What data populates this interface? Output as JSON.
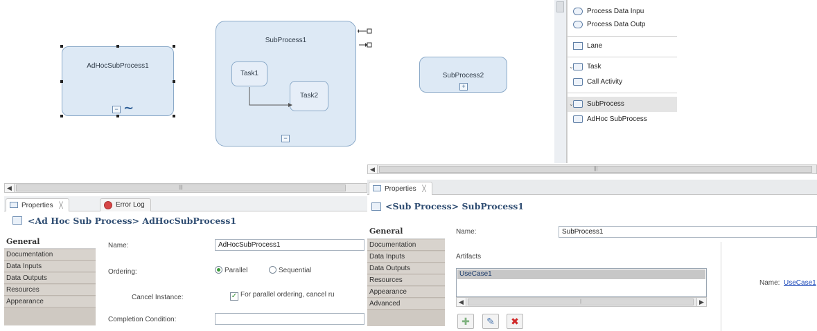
{
  "canvas": {
    "adhoc_label": "AdHocSubProcess1",
    "subprocess1_label": "SubProcess1",
    "task1_label": "Task1",
    "task2_label": "Task2",
    "subprocess2_label": "SubProcess2",
    "collapse_glyph": "−",
    "expand_glyph": "+",
    "adhoc_marker_glyph": "∼"
  },
  "palette": {
    "items": [
      {
        "label": "Process Data Inpu",
        "icon": "data-input-icon"
      },
      {
        "label": "Process Data Outp",
        "icon": "data-output-icon"
      },
      {
        "label": "Lane",
        "icon": "lane-icon"
      },
      {
        "label": "Task",
        "icon": "task-icon"
      },
      {
        "label": "Call Activity",
        "icon": "call-activity-icon"
      },
      {
        "label": "SubProcess",
        "icon": "subprocess-icon"
      },
      {
        "label": "AdHoc SubProcess",
        "icon": "adhoc-subprocess-icon"
      }
    ]
  },
  "left_panel": {
    "tabs": [
      {
        "label": "Properties",
        "close": "╳"
      },
      {
        "label": "Error Log"
      }
    ],
    "title": "<Ad Hoc Sub Process> AdHocSubProcess1",
    "side_tabs": [
      "General",
      "Documentation",
      "Data Inputs",
      "Data Outputs",
      "Resources",
      "Appearance"
    ],
    "name_label": "Name:",
    "name_value": "AdHocSubProcess1",
    "ordering_label": "Ordering:",
    "parallel_label": "Parallel",
    "sequential_label": "Sequential",
    "cancel_label": "Cancel Instance:",
    "cancel_check_label": "For parallel ordering, cancel ru",
    "completion_label": "Completion Condition:",
    "completion_value": ""
  },
  "right_panel": {
    "tabs": [
      {
        "label": "Properties",
        "close": "╳"
      }
    ],
    "title": "<Sub Process> SubProcess1",
    "side_tabs": [
      "General",
      "Documentation",
      "Data Inputs",
      "Data Outputs",
      "Resources",
      "Appearance",
      "Advanced"
    ],
    "name_label": "Name:",
    "name_value": "SubProcess1",
    "artifacts_label": "Artifacts",
    "artifacts": [
      "UseCase1"
    ],
    "detail_name_label": "Name:",
    "detail_name_link": "UseCase1"
  },
  "colors": {
    "shape_fill": "#dde9f5",
    "shape_border": "#8aa9c8",
    "title_blue": "#2f4d72",
    "link_blue": "#1a47b8"
  }
}
